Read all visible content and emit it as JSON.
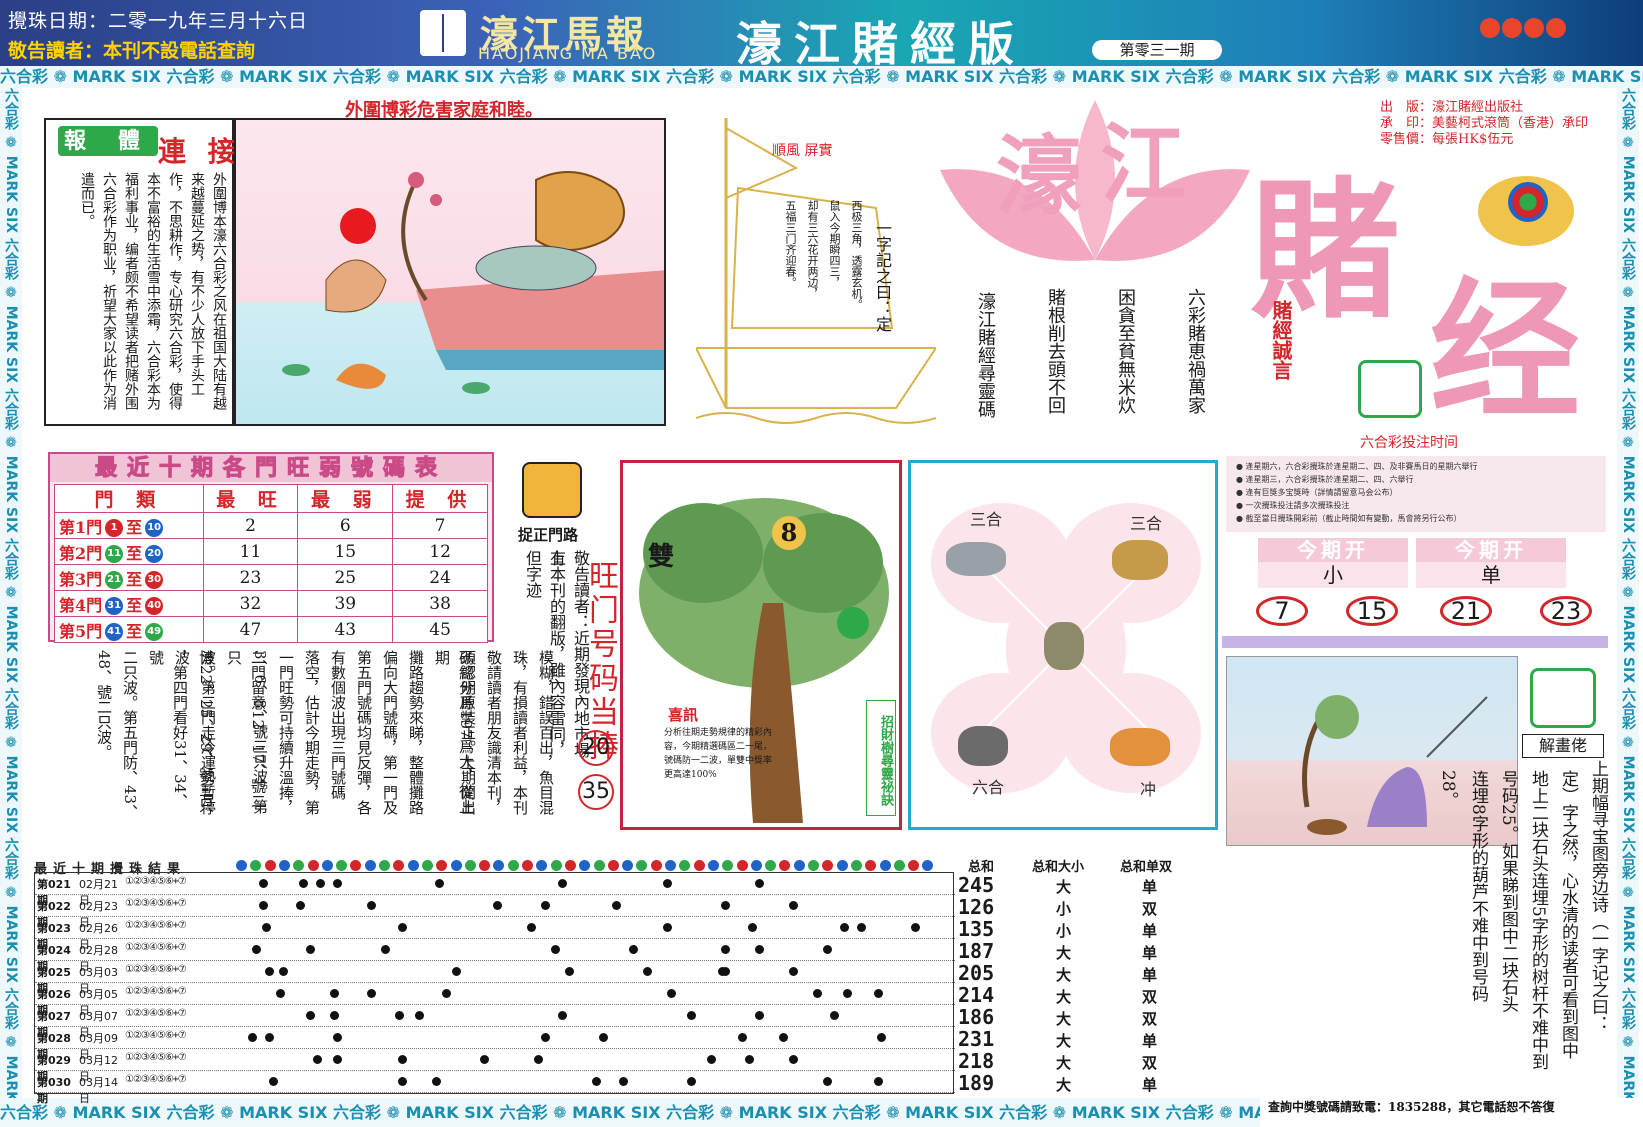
{
  "header": {
    "draw_date": "攪珠日期：二零一九年三月十六日",
    "warning": "敬告讀者：本刊不設電話查詢",
    "paper_name": "濠江馬報",
    "paper_name_en": "HAOJIANG MA BAO",
    "edition": "濠江賭經版",
    "issue": "第零三一期"
  },
  "strip_text": "六合彩 ❁ MARK SIX 六合彩 ❁ MARK SIX 六合彩 ❁ MARK SIX 六合彩 ❁ MARK SIX 六合彩 ❁ MARK SIX 六合彩 ❁ MARK SIX 六合彩 ❁ MARK SIX 六合彩 ❁ MARK SIX 六合彩 ❁ MARK SIX 六合彩 ❁ MARK SIX",
  "intro": {
    "headline": "外圍博彩危害家庭和睦。",
    "tag": "報 體",
    "tag2": "連 接",
    "body": "外圍博本濠六合彩之风在祖国大陆有越来越蔓延之势，有不少人放下手头工作，不思耕作，专心研究六合彩，使得本不富裕的生活雪中添霜，六合彩本为福利事业，编者颇不希望读者把赌外围六合彩作为职业，祈望大家以此作为消遣而已。"
  },
  "stats_table": {
    "title": "最近十期各門旺弱號碼表",
    "headers": [
      "門 類",
      "最 旺",
      "最 弱",
      "提 供"
    ],
    "rows": [
      {
        "gate": "第1門",
        "from": "1",
        "to": "10",
        "from_color": "#d4252a",
        "to_color": "#1f63c8",
        "max": "2",
        "min": "6",
        "offer": "7"
      },
      {
        "gate": "第2門",
        "from": "11",
        "to": "20",
        "from_color": "#2fa84a",
        "to_color": "#1f63c8",
        "max": "11",
        "min": "15",
        "offer": "12"
      },
      {
        "gate": "第3門",
        "from": "21",
        "to": "30",
        "from_color": "#2fa84a",
        "to_color": "#d4252a",
        "max": "23",
        "min": "25",
        "offer": "24"
      },
      {
        "gate": "第4門",
        "from": "31",
        "to": "40",
        "from_color": "#1f63c8",
        "to_color": "#d4252a",
        "max": "32",
        "min": "39",
        "offer": "38"
      },
      {
        "gate": "第5門",
        "from": "41",
        "to": "49",
        "from_color": "#1f63c8",
        "to_color": "#2fa84a",
        "max": "47",
        "min": "43",
        "offer": "45"
      }
    ]
  },
  "gate_note": {
    "label": "捉正門路",
    "col1": "有本刊的翻版，雖內容雷同，但字迹",
    "col2": "敬告讀者：近期發現內地市場上"
  },
  "wang": {
    "title": "旺门号码当捧",
    "n1": "20",
    "n2": "35"
  },
  "left_article": [
    "模糊，錯誤百出，魚目混",
    "珠，有損讀者利益，本刊",
    "敬請讀者朋友識清本刊，",
    "須認明原裝正。上期開出",
    "碼總分爲197爲大，從上期",
    "攤路趨勢來睇，整體攤路",
    "偏向大門號碼，第一門及",
    "第五門號碼均見反彈，各",
    "有數個波出現三門號碼",
    "落空，估計今期走勢，第",
    "一門旺勢可持續升溫捧，",
    "3、6、8、號三只波。第",
    "二門留意12、17、號二只",
    "波。第三門走冷運勢暫停",
    "博22、25、29、號三只波",
    "，第四門看好31、34、號",
    "二只波。第五門防、43、",
    "48、號二只波。"
  ],
  "ship": {
    "flag": "順風 屏實",
    "poem_cols": [
      "一字記之曰：定",
      "西极三角，透露玄机。",
      "鼠入今期瞬四三，",
      "却有三六花开两边，",
      "五福三门齐迎春。"
    ]
  },
  "proverbs": {
    "cols": [
      "六彩賭恵禍萬家",
      "困貪至貧無米炊",
      "賭根削去頭不回",
      "濠江賭經尋靈碼"
    ]
  },
  "brand": {
    "info1": "出　版：濠江賭經出版社",
    "info2": "承　印：美藝柯式滾筒（香港）承印",
    "info3": "零售價：每張HK$伍元",
    "t1": "濠",
    "t2": "江",
    "t3": "賭",
    "t4": "经",
    "warn": "賭經誠言",
    "time_label": "六合彩投注时间"
  },
  "tree": {
    "label_left": "雙",
    "label_num": "8",
    "note_title": "喜訊",
    "note_body": "分析往期走勢規律的精彩內容，今期精選碼區二一尾，號碼防一二波，單雙中獎率更高達100%",
    "side": "招財樹尋靈祕訣"
  },
  "zodiac": {
    "l1": "三合",
    "l2": "三合",
    "l3": "六合",
    "l4": "冲"
  },
  "schedule": [
    "● 逢星期六，六合彩攪珠於逢星期二、四、及非賽馬日的星期六舉行",
    "● 逢星期三，六合彩攪珠於逢星期二、四、六舉行",
    "● 逢有巨獎多宝獎時（詳情請留意马会公布）",
    "● 一次攪珠投注請多次攪珠投注",
    "● 截至當日攪珠開彩前（截止時間如有變動，馬會將另行公布）"
  ],
  "period": {
    "label1": "今期开",
    "label2": "今期开",
    "val1": "小",
    "val2": "单",
    "nums": [
      "7",
      "15",
      "21",
      "23"
    ]
  },
  "jie": {
    "label": "解畫佬",
    "cols": [
      "上期幅寻宝图旁边诗（一字记之曰：",
      "定）字之然，心水清的读者可看到图中",
      "地上二块石头连埋5字形的树杆不难中到",
      "号码25。如果睇到图中二块石头",
      "连埋8字形的葫芦不难中到号码",
      "28。"
    ]
  },
  "draw": {
    "title": "最近十期攪珠結果",
    "sum_head": "总和",
    "size_head": "总和大小",
    "odd_head": "总和单双",
    "rows": [
      {
        "issue": "第021期",
        "date": "02月21日",
        "nums": "①②③④⑤⑥+⑦",
        "sum": "245",
        "size": "大",
        "odd": "单"
      },
      {
        "issue": "第022期",
        "date": "02月23日",
        "nums": "①②③④⑤⑥+⑦",
        "sum": "126",
        "size": "小",
        "odd": "双"
      },
      {
        "issue": "第023期",
        "date": "02月26日",
        "nums": "①②③④⑤⑥+⑦",
        "sum": "135",
        "size": "小",
        "odd": "单"
      },
      {
        "issue": "第024期",
        "date": "02月28日",
        "nums": "①②③④⑤⑥+⑦",
        "sum": "187",
        "size": "大",
        "odd": "单"
      },
      {
        "issue": "第025期",
        "date": "03月03日",
        "nums": "①②③④⑤⑥+⑦",
        "sum": "205",
        "size": "大",
        "odd": "单"
      },
      {
        "issue": "第026期",
        "date": "03月05日",
        "nums": "①②③④⑤⑥+⑦",
        "sum": "214",
        "size": "大",
        "odd": "双"
      },
      {
        "issue": "第027期",
        "date": "03月07日",
        "nums": "①②③④⑤⑥+⑦",
        "sum": "186",
        "size": "大",
        "odd": "双"
      },
      {
        "issue": "第028期",
        "date": "03月09日",
        "nums": "①②③④⑤⑥+⑦",
        "sum": "231",
        "size": "大",
        "odd": "单"
      },
      {
        "issue": "第029期",
        "date": "03月12日",
        "nums": "①②③④⑤⑥+⑦",
        "sum": "218",
        "size": "大",
        "odd": "双"
      },
      {
        "issue": "第030期",
        "date": "03月14日",
        "nums": "①②③④⑤⑥+⑦",
        "sum": "189",
        "size": "大",
        "odd": "单"
      }
    ]
  },
  "bottom": {
    "phone": "查詢中獎號碼請致電：1835288，其它電話恕不答復"
  }
}
